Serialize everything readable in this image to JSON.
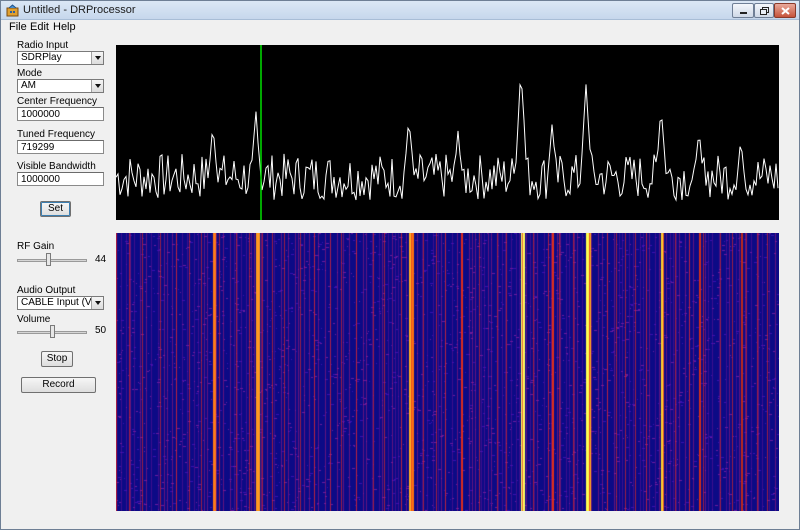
{
  "window": {
    "title": "Untitled - DRProcessor"
  },
  "menu": [
    "File",
    "Edit",
    "Help"
  ],
  "controls": {
    "radio_input": {
      "label": "Radio Input",
      "value": "SDRPlay"
    },
    "mode": {
      "label": "Mode",
      "value": "AM"
    },
    "center_frequency": {
      "label": "Center Frequency",
      "value": "1000000"
    },
    "tuned_frequency": {
      "label": "Tuned Frequency",
      "value": "719299"
    },
    "visible_bandwidth": {
      "label": "Visible Bandwidth",
      "value": "1000000"
    },
    "set_label": "Set",
    "rf_gain": {
      "label": "RF Gain",
      "value": 44,
      "fraction": 0.44
    },
    "audio_output": {
      "label": "Audio Output",
      "value": "CABLE Input (VB-Audio"
    },
    "volume": {
      "label": "Volume",
      "value": 50,
      "fraction": 0.5
    },
    "stop_label": "Stop",
    "record_label": "Record"
  },
  "colors": {
    "spectrum_bg": "#000000",
    "spectrum_line": "#ffffff",
    "tuned_marker": "#00e000",
    "waterfall_bg": "#0c0a86"
  }
}
